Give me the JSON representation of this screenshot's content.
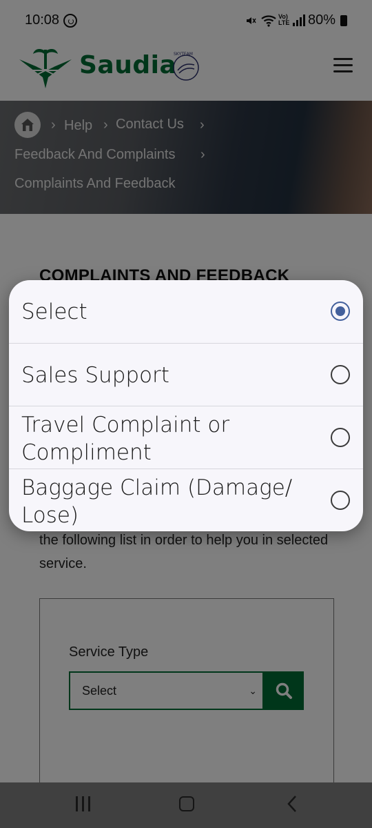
{
  "status_bar": {
    "time": "10:08",
    "volte_line1": "Vo)",
    "volte_line2": "LTE",
    "battery": "80%"
  },
  "header": {
    "brand": "Saudia",
    "skyteam": "SKYTEAM"
  },
  "breadcrumb": {
    "items": [
      "Help",
      "Contact Us",
      "Feedback And Complaints",
      "Complaints And Feedback"
    ]
  },
  "page": {
    "heading": "COMPLAINTS AND FEEDBACK",
    "description": "the following list in order to help you in selected service.",
    "form": {
      "field_label": "Service Type",
      "select_value": "Select"
    }
  },
  "dialog": {
    "options": [
      {
        "label": "Select",
        "selected": true
      },
      {
        "label": "Sales Support",
        "selected": false
      },
      {
        "label": "Travel Complaint or Compliment",
        "selected": false
      },
      {
        "label": "Baggage Claim (Damage/ Lose)",
        "selected": false
      }
    ]
  },
  "colors": {
    "brand": "#006c35",
    "radio_selected": "#43609c"
  },
  "icons": {
    "status": [
      "whatsapp-icon",
      "mute-icon",
      "wifi-icon",
      "signal-icon",
      "battery-icon"
    ],
    "header": [
      "saudia-logo-icon",
      "skyteam-icon",
      "menu-icon"
    ],
    "hero": [
      "home-icon",
      "chevron-right-icon"
    ],
    "form": [
      "chevron-down-icon",
      "search-icon"
    ],
    "nav": [
      "recents-icon",
      "home-nav-icon",
      "back-icon"
    ]
  }
}
